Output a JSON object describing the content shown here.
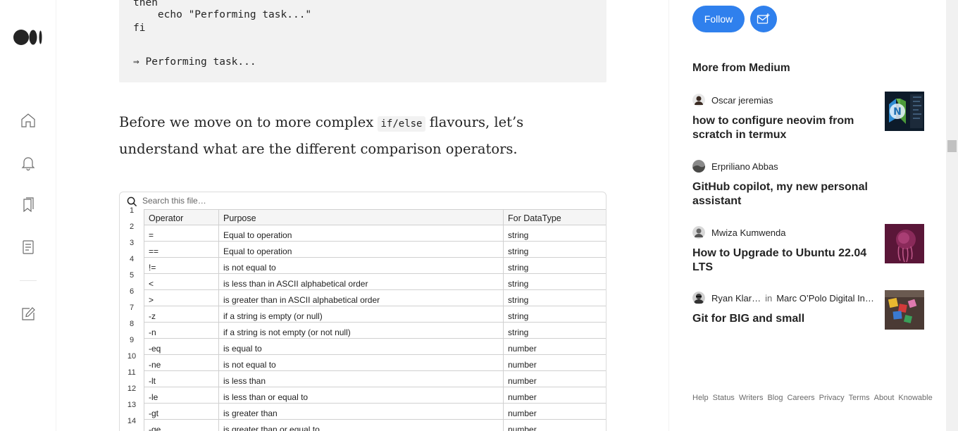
{
  "code_block": {
    "lines": [
      "then",
      "    echo \"Performing task...\"",
      "fi",
      "",
      "⇒ Performing task..."
    ]
  },
  "paragraph": {
    "before": "Before we move on to more complex ",
    "code": "if/else",
    "after": " flavours, let’s understand what are the different comparison operators."
  },
  "embed": {
    "search_placeholder": "Search this file…",
    "header": {
      "ln": "1",
      "operator": "Operator",
      "purpose": "Purpose",
      "datatype": "For DataType"
    },
    "rows": [
      {
        "ln": "2",
        "operator": "=",
        "purpose": "Equal to operation",
        "datatype": "string"
      },
      {
        "ln": "3",
        "operator": "==",
        "purpose": "Equal to operation",
        "datatype": "string"
      },
      {
        "ln": "4",
        "operator": "!=",
        "purpose": "is not equal to",
        "datatype": "string"
      },
      {
        "ln": "5",
        "operator": "<",
        "purpose": "is less than in ASCII alphabetical order",
        "datatype": "string"
      },
      {
        "ln": "6",
        "operator": ">",
        "purpose": "is greater than in ASCII alphabetical order",
        "datatype": "string"
      },
      {
        "ln": "7",
        "operator": "-z",
        "purpose": "if a string is empty (or null)",
        "datatype": "string"
      },
      {
        "ln": "8",
        "operator": "-n",
        "purpose": "if a string is not empty (or not null)",
        "datatype": "string"
      },
      {
        "ln": "9",
        "operator": "-eq",
        "purpose": "is equal to",
        "datatype": "number"
      },
      {
        "ln": "10",
        "operator": "-ne",
        "purpose": "is not equal to",
        "datatype": "number"
      },
      {
        "ln": "11",
        "operator": "-lt",
        "purpose": "is less than",
        "datatype": "number"
      },
      {
        "ln": "12",
        "operator": "-le",
        "purpose": "is less than or equal to",
        "datatype": "number"
      },
      {
        "ln": "13",
        "operator": "-gt",
        "purpose": "is greater than",
        "datatype": "number"
      },
      {
        "ln": "14",
        "operator": "-ge",
        "purpose": "is greater than or equal to",
        "datatype": "number"
      }
    ]
  },
  "sidebar": {
    "follow_label": "Follow",
    "more_from": "More from Medium",
    "stories": [
      {
        "author": "Oscar jeremias",
        "title": "how to configure neovim from scratch in termux",
        "thumb": "neovim-logo"
      },
      {
        "author": "Erpriliano Abbas",
        "title": "GitHub copilot, my new personal assistant"
      },
      {
        "author": "Mwiza Kumwenda",
        "title": "How to Upgrade to Ubuntu 22.04 LTS",
        "thumb": "ubuntu-jellyfish"
      },
      {
        "author": "Ryan Klar…",
        "in_word": "in",
        "publication": "Marc O’Polo Digital In…",
        "title": "Git for BIG and small",
        "thumb": "git-letters"
      }
    ],
    "footer_links": [
      "Help",
      "Status",
      "Writers",
      "Blog",
      "Careers",
      "Privacy",
      "Terms",
      "About",
      "Knowable"
    ]
  },
  "colors": {
    "accent": "#2f80ed",
    "code_bg": "#f2f2f2",
    "text": "#242424",
    "muted": "#6b6b6b"
  },
  "icons": {
    "logo": "medium-logo-icon",
    "nav": [
      "home-icon",
      "bell-icon",
      "bookmarks-icon",
      "stories-icon",
      "write-icon"
    ],
    "search": "search-icon",
    "subscribe": "mail-plus-icon"
  }
}
